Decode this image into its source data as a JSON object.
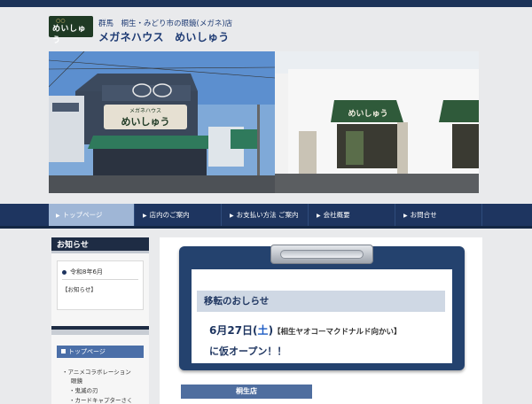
{
  "header": {
    "logo_text": "めいしゅう",
    "tagline": "群馬　桐生・みどり市の眼鏡(メガネ)店",
    "site_name": "メガネハウス　めいしゅう"
  },
  "hero": {
    "left_sign": "めいしゅう",
    "left_sign_small": "メガネハウス",
    "right_sign": "めいしゅう"
  },
  "nav": {
    "items": [
      {
        "label": "トップページ"
      },
      {
        "label": "店内のご案内"
      },
      {
        "label": "お支払い方法 ご案内"
      },
      {
        "label": "会社概要"
      },
      {
        "label": "お問合せ"
      }
    ]
  },
  "sidebar": {
    "heading": "お知らせ",
    "news_date": "令和8年6月",
    "news_category": "【お知らせ】",
    "menu_head": "トップページ",
    "sub_items": [
      "・アニメコラボレーション",
      "眼鏡",
      "・鬼滅の刃",
      "・カードキャプターさく"
    ]
  },
  "main": {
    "notice_title": "移転のおしらせ",
    "notice_date": "6月27日(",
    "notice_day": "土",
    "notice_date_close": ")",
    "notice_location": "【相生ヤオコーマクドナルド向かい】",
    "notice_open": "に仮オープン！！",
    "branch": "桐生店"
  },
  "colors": {
    "navy": "#1e3560",
    "nav_active": "#9fb6d6",
    "notice_bg": "#cfd8e4"
  }
}
